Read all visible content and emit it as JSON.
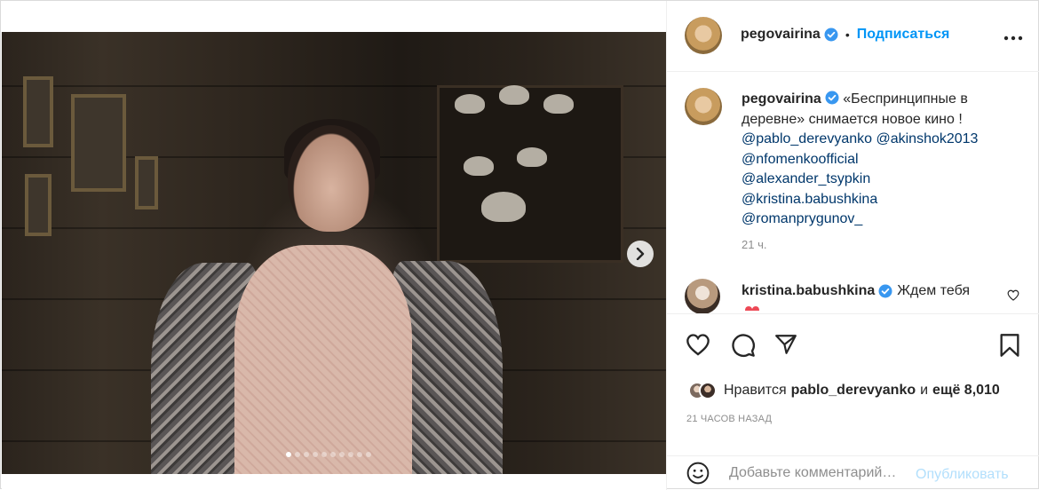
{
  "post": {
    "author": "pegovairina",
    "follow_label": "Подписаться",
    "separator": "•",
    "more_label": "•••",
    "slides_count": 10,
    "active_slide": 0
  },
  "caption": {
    "author": "pegovairina",
    "text": "«Беспринципные в деревне» снимается новое кино !",
    "mentions": [
      "@pablo_derevyanko",
      "@akinshok2013",
      "@nfomenkoofficial",
      "@alexander_tsypkin",
      "@kristina.babushkina",
      "@romanprygunov_"
    ],
    "time": "21 ч."
  },
  "comment": {
    "author": "kristina.babushkina",
    "text": "Ждем тебя"
  },
  "likes": {
    "prefix": "Нравится",
    "user": "pablo_derevyanko",
    "middle": "и",
    "rest": "ещё 8,010"
  },
  "timestamp": "21 ЧАСОВ НАЗАД",
  "add_comment": {
    "placeholder": "Добавьте комментарий…",
    "publish_label": "Опубликовать"
  },
  "colors": {
    "accent": "#0095f6",
    "verified": "#3897f0",
    "mention": "#00376b",
    "muted": "#8e8e8e"
  },
  "icons": [
    "chevron-right-icon",
    "verified-badge-icon",
    "more-icon",
    "heart-icon",
    "comment-icon",
    "share-icon",
    "bookmark-icon",
    "emoji-icon"
  ]
}
